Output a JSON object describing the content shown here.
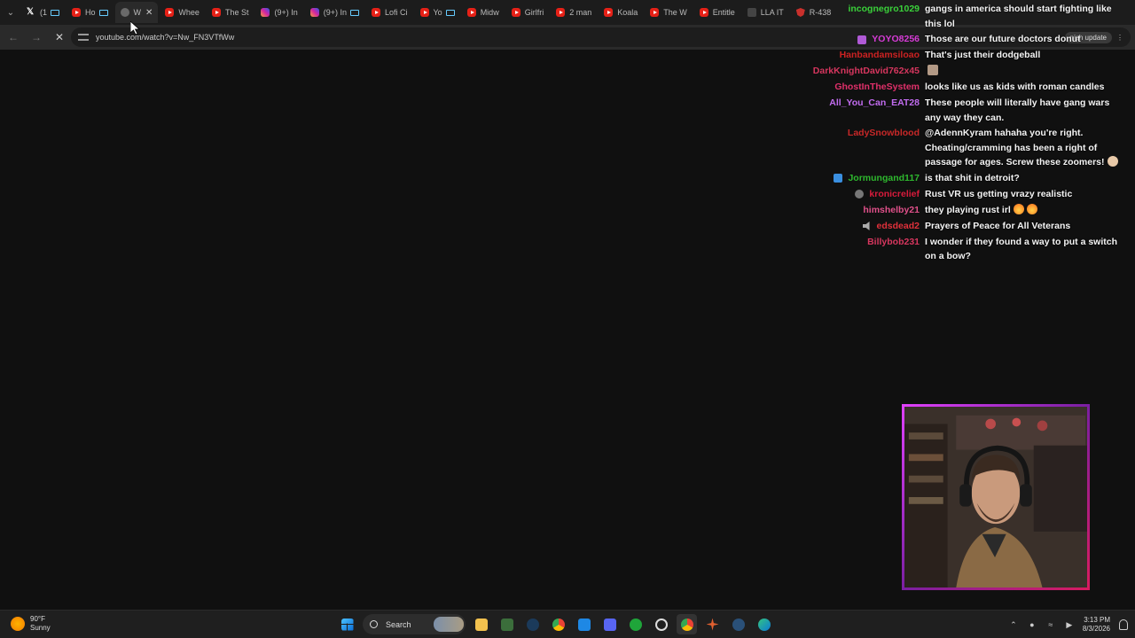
{
  "browser": {
    "tabs": [
      {
        "label": "(1",
        "icon": "x-icon",
        "active": false,
        "audio": true
      },
      {
        "label": "Ho",
        "icon": "youtube-icon",
        "active": false,
        "audio": true
      },
      {
        "label": "W",
        "icon": "loading-icon",
        "active": true,
        "audio": false
      },
      {
        "label": "Whee",
        "icon": "youtube-icon",
        "active": false,
        "audio": false
      },
      {
        "label": "The St",
        "icon": "youtube-icon",
        "active": false,
        "audio": false
      },
      {
        "label": "(9+) In",
        "icon": "instagram-icon",
        "active": false,
        "audio": false
      },
      {
        "label": "(9+) In",
        "icon": "instagram-icon",
        "active": false,
        "audio": true
      },
      {
        "label": "Lofi Ci",
        "icon": "youtube-icon",
        "active": false,
        "audio": false
      },
      {
        "label": "Yo",
        "icon": "youtube-icon",
        "active": false,
        "audio": true
      },
      {
        "label": "Midw",
        "icon": "youtube-icon",
        "active": false,
        "audio": false
      },
      {
        "label": "Girlfri",
        "icon": "youtube-icon",
        "active": false,
        "audio": false
      },
      {
        "label": "2 man",
        "icon": "youtube-icon",
        "active": false,
        "audio": false
      },
      {
        "label": "Koala",
        "icon": "youtube-icon",
        "active": false,
        "audio": false
      },
      {
        "label": "The W",
        "icon": "youtube-icon",
        "active": false,
        "audio": false
      },
      {
        "label": "Entitle",
        "icon": "youtube-icon",
        "active": false,
        "audio": false
      },
      {
        "label": "LLA IT",
        "icon": "letter-icon",
        "active": false,
        "audio": false
      },
      {
        "label": "R-438",
        "icon": "shield-icon",
        "active": false,
        "audio": false
      }
    ],
    "url": "youtube.com/watch?v=Nw_FN3VTfWw",
    "update_label": "nish update"
  },
  "chat": {
    "messages": [
      {
        "user": "incognegro1029",
        "color": "#3ad13a",
        "badge": "",
        "text": "gangs in america should start fighting like this lol",
        "emote": ""
      },
      {
        "user": "YOYO8256",
        "color": "#d63bd6",
        "badge": "sub",
        "text": "Those are our future doctors donut",
        "emote": ""
      },
      {
        "user": "Hanbandamsiloao",
        "color": "#cc2222",
        "badge": "",
        "text": "That's just their dodgeball",
        "emote": ""
      },
      {
        "user": "DarkKnightDavid762x45",
        "color": "#d6365e",
        "badge": "",
        "text": "",
        "emote": "avatar"
      },
      {
        "user": "GhostInTheSystem",
        "color": "#e0306a",
        "badge": "",
        "text": "looks like us as kids with roman candles",
        "emote": ""
      },
      {
        "user": "All_You_Can_EAT28",
        "color": "#c26cf0",
        "badge": "",
        "text": "These people will literally have gang wars any way they can.",
        "emote": ""
      },
      {
        "user": "LadySnowblood",
        "color": "#c82828",
        "badge": "",
        "text": "@AdennKyram hahaha you're right. Cheating/cramming has been a right of passage for ages. Screw these zoomers!",
        "emote": "hand"
      },
      {
        "user": "Jormungand117",
        "color": "#2eb82e",
        "badge": "mod",
        "text": "is that shit in detroit?",
        "emote": ""
      },
      {
        "user": "kronicrelief",
        "color": "#d81b3c",
        "badge": "vip",
        "text": "Rust VR us getting vrazy realistic",
        "emote": ""
      },
      {
        "user": "himshelby21",
        "color": "#e0508a",
        "badge": "",
        "text": "they playing rust irl",
        "emote": "fire"
      },
      {
        "user": "edsdead2",
        "color": "#e0303a",
        "badge": "mute",
        "text": "Prayers of Peace for All Veterans",
        "emote": ""
      },
      {
        "user": "Billybob231",
        "color": "#d6365e",
        "badge": "",
        "text": "I wonder if they found a way to put a switch on a bow?",
        "emote": ""
      }
    ]
  },
  "taskbar": {
    "temperature": "90°F",
    "condition": "Sunny",
    "search_label": "Search",
    "time": "3:13 PM",
    "date": "8/3/2026"
  }
}
